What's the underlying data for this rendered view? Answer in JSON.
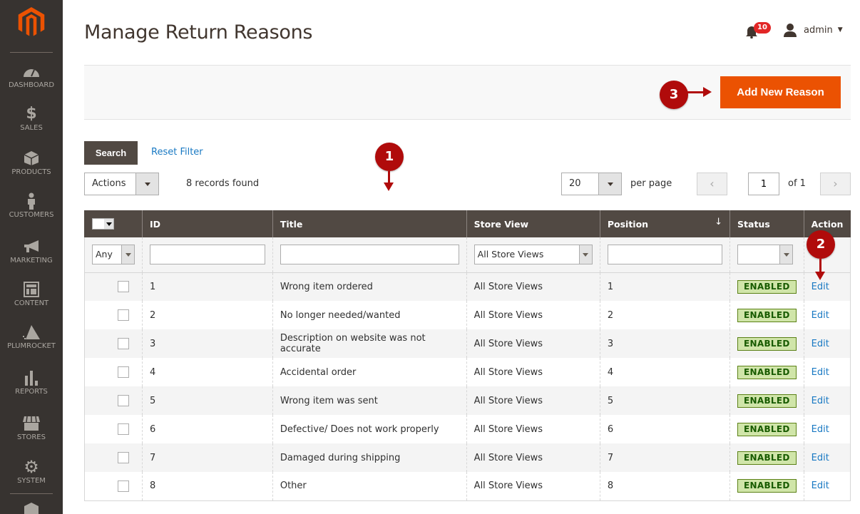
{
  "sidebar": {
    "items": [
      {
        "label": "DASHBOARD",
        "icon": "dashboard-icon"
      },
      {
        "label": "SALES",
        "icon": "dollar-icon"
      },
      {
        "label": "PRODUCTS",
        "icon": "box-icon"
      },
      {
        "label": "CUSTOMERS",
        "icon": "person-icon"
      },
      {
        "label": "MARKETING",
        "icon": "megaphone-icon"
      },
      {
        "label": "CONTENT",
        "icon": "layout-icon"
      },
      {
        "label": "PLUMROCKET",
        "icon": "plumrocket-icon"
      },
      {
        "label": "REPORTS",
        "icon": "bar-chart-icon"
      },
      {
        "label": "STORES",
        "icon": "storefront-icon"
      },
      {
        "label": "SYSTEM",
        "icon": "gear-icon"
      }
    ]
  },
  "header": {
    "title": "Manage Return Reasons",
    "notification_count": "10",
    "user_name": "admin"
  },
  "page_actions": {
    "add_button": "Add New Reason"
  },
  "grid": {
    "search_button": "Search",
    "reset_filter": "Reset Filter",
    "actions_select": "Actions",
    "records_found": "8 records found",
    "per_page_value": "20",
    "per_page_label": "per page",
    "current_page": "1",
    "of_pages": "of 1",
    "columns": [
      "ID",
      "Title",
      "Store View",
      "Position",
      "Status",
      "Action"
    ],
    "filters": {
      "mass": "Any",
      "store_view": "All Store Views",
      "status": ""
    },
    "rows": [
      {
        "id": "1",
        "title": "Wrong item ordered",
        "store_view": "All Store Views",
        "position": "1",
        "status": "ENABLED",
        "action": "Edit"
      },
      {
        "id": "2",
        "title": "No longer needed/wanted",
        "store_view": "All Store Views",
        "position": "2",
        "status": "ENABLED",
        "action": "Edit"
      },
      {
        "id": "3",
        "title": "Description on website was not accurate",
        "store_view": "All Store Views",
        "position": "3",
        "status": "ENABLED",
        "action": "Edit"
      },
      {
        "id": "4",
        "title": "Accidental order",
        "store_view": "All Store Views",
        "position": "4",
        "status": "ENABLED",
        "action": "Edit"
      },
      {
        "id": "5",
        "title": "Wrong item was sent",
        "store_view": "All Store Views",
        "position": "5",
        "status": "ENABLED",
        "action": "Edit"
      },
      {
        "id": "6",
        "title": "Defective/ Does not work properly",
        "store_view": "All Store Views",
        "position": "6",
        "status": "ENABLED",
        "action": "Edit"
      },
      {
        "id": "7",
        "title": "Damaged during shipping",
        "store_view": "All Store Views",
        "position": "7",
        "status": "ENABLED",
        "action": "Edit"
      },
      {
        "id": "8",
        "title": "Other",
        "store_view": "All Store Views",
        "position": "8",
        "status": "ENABLED",
        "action": "Edit"
      }
    ]
  },
  "callouts": [
    "1",
    "2",
    "3"
  ],
  "colors": {
    "sidebar_bg": "#373330",
    "primary_button": "#eb5202",
    "header_row": "#514943",
    "callout": "#b00b0b",
    "link": "#1979c3",
    "enabled_bg": "#d0e5a9"
  }
}
